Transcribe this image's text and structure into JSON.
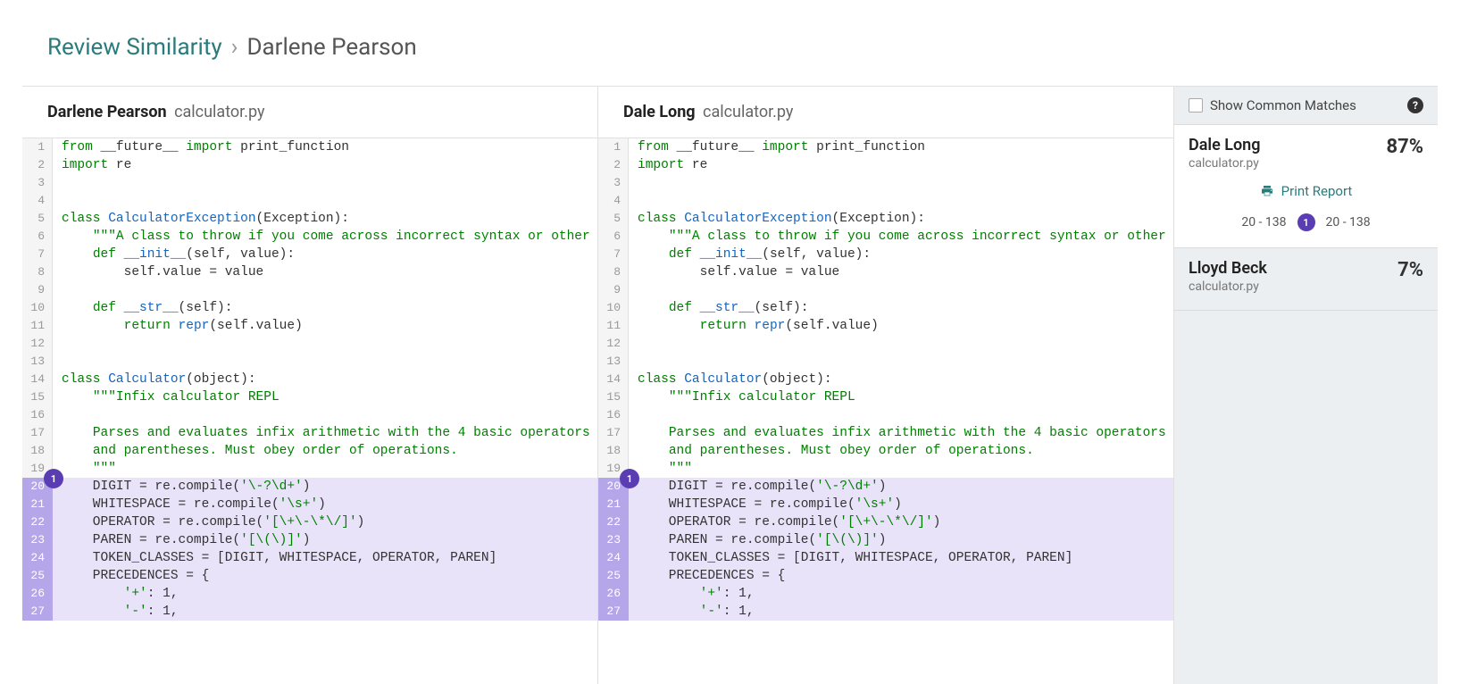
{
  "breadcrumb": {
    "link": "Review Similarity",
    "current": "Darlene Pearson"
  },
  "left": {
    "name": "Darlene Pearson",
    "file": "calculator.py",
    "badge": "1",
    "lines": [
      {
        "n": 1,
        "hl": false,
        "tokens": [
          [
            "kw",
            "from"
          ],
          [
            "",
            " __future__ "
          ],
          [
            "kw",
            "import"
          ],
          [
            "",
            " print_function"
          ]
        ]
      },
      {
        "n": 2,
        "hl": false,
        "tokens": [
          [
            "kw",
            "import"
          ],
          [
            "",
            " re"
          ]
        ]
      },
      {
        "n": 3,
        "hl": false,
        "tokens": []
      },
      {
        "n": 4,
        "hl": false,
        "tokens": []
      },
      {
        "n": 5,
        "hl": false,
        "tokens": [
          [
            "kw",
            "class"
          ],
          [
            "",
            " "
          ],
          [
            "nm",
            "CalculatorException"
          ],
          [
            "",
            "(Exception):"
          ]
        ]
      },
      {
        "n": 6,
        "hl": false,
        "tokens": [
          [
            "",
            "    "
          ],
          [
            "doc",
            "\"\"\"A class to throw if you come across incorrect syntax or other issues\"\""
          ]
        ]
      },
      {
        "n": 7,
        "hl": false,
        "tokens": [
          [
            "",
            "    "
          ],
          [
            "kw",
            "def"
          ],
          [
            "",
            " "
          ],
          [
            "nm",
            "__init__"
          ],
          [
            "",
            "(self, value):"
          ]
        ]
      },
      {
        "n": 8,
        "hl": false,
        "tokens": [
          [
            "",
            "        self.value = value"
          ]
        ]
      },
      {
        "n": 9,
        "hl": false,
        "tokens": []
      },
      {
        "n": 10,
        "hl": false,
        "tokens": [
          [
            "",
            "    "
          ],
          [
            "kw",
            "def"
          ],
          [
            "",
            " "
          ],
          [
            "nm",
            "__str__"
          ],
          [
            "",
            "(self):"
          ]
        ]
      },
      {
        "n": 11,
        "hl": false,
        "tokens": [
          [
            "",
            "        "
          ],
          [
            "kw",
            "return"
          ],
          [
            "",
            " "
          ],
          [
            "nm",
            "repr"
          ],
          [
            "",
            "(self.value)"
          ]
        ]
      },
      {
        "n": 12,
        "hl": false,
        "tokens": []
      },
      {
        "n": 13,
        "hl": false,
        "tokens": []
      },
      {
        "n": 14,
        "hl": false,
        "tokens": [
          [
            "kw",
            "class"
          ],
          [
            "",
            " "
          ],
          [
            "nm",
            "Calculator"
          ],
          [
            "",
            "(object):"
          ]
        ]
      },
      {
        "n": 15,
        "hl": false,
        "tokens": [
          [
            "",
            "    "
          ],
          [
            "doc",
            "\"\"\"Infix calculator REPL"
          ]
        ]
      },
      {
        "n": 16,
        "hl": false,
        "tokens": []
      },
      {
        "n": 17,
        "hl": false,
        "tokens": [
          [
            "",
            "    "
          ],
          [
            "doc",
            "Parses and evaluates infix arithmetic with the 4 basic operators"
          ]
        ]
      },
      {
        "n": 18,
        "hl": false,
        "tokens": [
          [
            "",
            "    "
          ],
          [
            "doc",
            "and parentheses. Must obey order of operations."
          ]
        ]
      },
      {
        "n": 19,
        "hl": false,
        "tokens": [
          [
            "",
            "    "
          ],
          [
            "doc",
            "\"\"\""
          ]
        ]
      },
      {
        "n": 20,
        "hl": true,
        "tokens": [
          [
            "",
            "    DIGIT = re.compile("
          ],
          [
            "str",
            "'\\-?\\d+'"
          ],
          [
            "",
            ")"
          ]
        ]
      },
      {
        "n": 21,
        "hl": true,
        "tokens": [
          [
            "",
            "    WHITESPACE = re.compile("
          ],
          [
            "str",
            "'\\s+'"
          ],
          [
            "",
            ")"
          ]
        ]
      },
      {
        "n": 22,
        "hl": true,
        "tokens": [
          [
            "",
            "    OPERATOR = re.compile("
          ],
          [
            "str",
            "'[\\+\\-\\*\\/]'"
          ],
          [
            "",
            ")"
          ]
        ]
      },
      {
        "n": 23,
        "hl": true,
        "tokens": [
          [
            "",
            "    PAREN = re.compile("
          ],
          [
            "str",
            "'[\\(\\)]'"
          ],
          [
            "",
            ")"
          ]
        ]
      },
      {
        "n": 24,
        "hl": true,
        "tokens": [
          [
            "",
            "    TOKEN_CLASSES = [DIGIT, WHITESPACE, OPERATOR, PAREN]"
          ]
        ]
      },
      {
        "n": 25,
        "hl": true,
        "tokens": [
          [
            "",
            "    PRECEDENCES = {"
          ]
        ]
      },
      {
        "n": 26,
        "hl": true,
        "tokens": [
          [
            "",
            "        "
          ],
          [
            "str",
            "'+'"
          ],
          [
            "",
            ": 1,"
          ]
        ]
      },
      {
        "n": 27,
        "hl": true,
        "tokens": [
          [
            "",
            "        "
          ],
          [
            "str",
            "'-'"
          ],
          [
            "",
            ": 1,"
          ]
        ]
      }
    ]
  },
  "right": {
    "name": "Dale Long",
    "file": "calculator.py",
    "badge": "1",
    "lines": [
      {
        "n": 1,
        "hl": false,
        "tokens": [
          [
            "kw",
            "from"
          ],
          [
            "",
            " __future__ "
          ],
          [
            "kw",
            "import"
          ],
          [
            "",
            " print_function"
          ]
        ]
      },
      {
        "n": 2,
        "hl": false,
        "tokens": [
          [
            "kw",
            "import"
          ],
          [
            "",
            " re"
          ]
        ]
      },
      {
        "n": 3,
        "hl": false,
        "tokens": []
      },
      {
        "n": 4,
        "hl": false,
        "tokens": []
      },
      {
        "n": 5,
        "hl": false,
        "tokens": [
          [
            "kw",
            "class"
          ],
          [
            "",
            " "
          ],
          [
            "nm",
            "CalculatorException"
          ],
          [
            "",
            "(Exception):"
          ]
        ]
      },
      {
        "n": 6,
        "hl": false,
        "tokens": [
          [
            "",
            "    "
          ],
          [
            "doc",
            "\"\"\"A class to throw if you come across incorrect syntax or other issues\"\""
          ]
        ]
      },
      {
        "n": 7,
        "hl": false,
        "tokens": [
          [
            "",
            "    "
          ],
          [
            "kw",
            "def"
          ],
          [
            "",
            " "
          ],
          [
            "nm",
            "__init__"
          ],
          [
            "",
            "(self, value):"
          ]
        ]
      },
      {
        "n": 8,
        "hl": false,
        "tokens": [
          [
            "",
            "        self.value = value"
          ]
        ]
      },
      {
        "n": 9,
        "hl": false,
        "tokens": []
      },
      {
        "n": 10,
        "hl": false,
        "tokens": [
          [
            "",
            "    "
          ],
          [
            "kw",
            "def"
          ],
          [
            "",
            " "
          ],
          [
            "nm",
            "__str__"
          ],
          [
            "",
            "(self):"
          ]
        ]
      },
      {
        "n": 11,
        "hl": false,
        "tokens": [
          [
            "",
            "        "
          ],
          [
            "kw",
            "return"
          ],
          [
            "",
            " "
          ],
          [
            "nm",
            "repr"
          ],
          [
            "",
            "(self.value)"
          ]
        ]
      },
      {
        "n": 12,
        "hl": false,
        "tokens": []
      },
      {
        "n": 13,
        "hl": false,
        "tokens": []
      },
      {
        "n": 14,
        "hl": false,
        "tokens": [
          [
            "kw",
            "class"
          ],
          [
            "",
            " "
          ],
          [
            "nm",
            "Calculator"
          ],
          [
            "",
            "(object):"
          ]
        ]
      },
      {
        "n": 15,
        "hl": false,
        "tokens": [
          [
            "",
            "    "
          ],
          [
            "doc",
            "\"\"\"Infix calculator REPL"
          ]
        ]
      },
      {
        "n": 16,
        "hl": false,
        "tokens": []
      },
      {
        "n": 17,
        "hl": false,
        "tokens": [
          [
            "",
            "    "
          ],
          [
            "doc",
            "Parses and evaluates infix arithmetic with the 4 basic operators"
          ]
        ]
      },
      {
        "n": 18,
        "hl": false,
        "tokens": [
          [
            "",
            "    "
          ],
          [
            "doc",
            "and parentheses. Must obey order of operations."
          ]
        ]
      },
      {
        "n": 19,
        "hl": false,
        "tokens": [
          [
            "",
            "    "
          ],
          [
            "doc",
            "\"\"\""
          ]
        ]
      },
      {
        "n": 20,
        "hl": true,
        "tokens": [
          [
            "",
            "    DIGIT = re.compile("
          ],
          [
            "str",
            "'\\-?\\d+'"
          ],
          [
            "",
            ")"
          ]
        ]
      },
      {
        "n": 21,
        "hl": true,
        "tokens": [
          [
            "",
            "    WHITESPACE = re.compile("
          ],
          [
            "str",
            "'\\s+'"
          ],
          [
            "",
            ")"
          ]
        ]
      },
      {
        "n": 22,
        "hl": true,
        "tokens": [
          [
            "",
            "    OPERATOR = re.compile("
          ],
          [
            "str",
            "'[\\+\\-\\*\\/]'"
          ],
          [
            "",
            ")"
          ]
        ]
      },
      {
        "n": 23,
        "hl": true,
        "tokens": [
          [
            "",
            "    PAREN = re.compile("
          ],
          [
            "str",
            "'[\\(\\)]'"
          ],
          [
            "",
            ")"
          ]
        ]
      },
      {
        "n": 24,
        "hl": true,
        "tokens": [
          [
            "",
            "    TOKEN_CLASSES = [DIGIT, WHITESPACE, OPERATOR, PAREN]"
          ]
        ]
      },
      {
        "n": 25,
        "hl": true,
        "tokens": [
          [
            "",
            "    PRECEDENCES = {"
          ]
        ]
      },
      {
        "n": 26,
        "hl": true,
        "tokens": [
          [
            "",
            "        "
          ],
          [
            "str",
            "'+'"
          ],
          [
            "",
            ": 1,"
          ]
        ]
      },
      {
        "n": 27,
        "hl": true,
        "tokens": [
          [
            "",
            "        "
          ],
          [
            "str",
            "'-'"
          ],
          [
            "",
            ": 1,"
          ]
        ]
      }
    ]
  },
  "sidebar": {
    "show_common_label": "Show Common Matches",
    "matches": [
      {
        "name": "Dale Long",
        "file": "calculator.py",
        "pct": "87%",
        "active": true,
        "print_label": "Print Report",
        "range_left": "20 - 138",
        "range_badge": "1",
        "range_right": "20 - 138"
      },
      {
        "name": "Lloyd Beck",
        "file": "calculator.py",
        "pct": "7%",
        "active": false
      }
    ]
  }
}
